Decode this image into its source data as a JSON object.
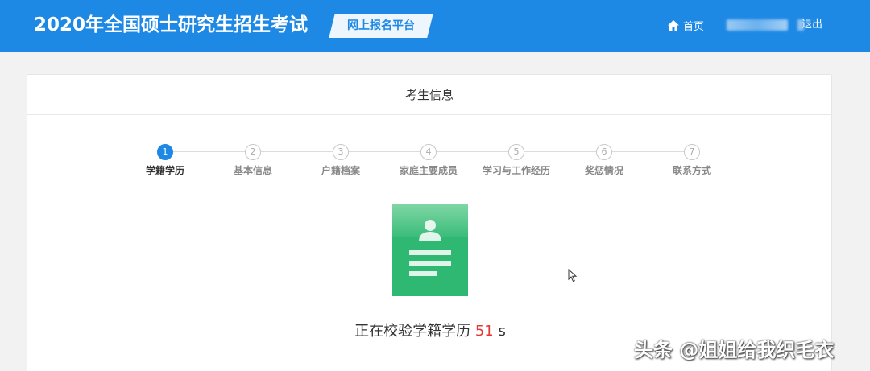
{
  "header": {
    "title": "2020年全国硕士研究生招生考试",
    "platform": "网上报名平台",
    "nav": {
      "home": "首页",
      "logout": "退出"
    }
  },
  "card": {
    "title": "考生信息",
    "steps": [
      {
        "num": "1",
        "label": "学籍学历",
        "active": true
      },
      {
        "num": "2",
        "label": "基本信息",
        "active": false
      },
      {
        "num": "3",
        "label": "户籍档案",
        "active": false
      },
      {
        "num": "4",
        "label": "家庭主要成员",
        "active": false
      },
      {
        "num": "5",
        "label": "学习与工作经历",
        "active": false
      },
      {
        "num": "6",
        "label": "奖惩情况",
        "active": false
      },
      {
        "num": "7",
        "label": "联系方式",
        "active": false
      }
    ],
    "verify": {
      "prefix": "正在校验学籍学历",
      "count": "51",
      "unit": "s"
    }
  },
  "watermark": "头条 @姐姐给我织毛衣",
  "colors": {
    "primary": "#1e88e5",
    "card_green": "#2fb872",
    "countdown": "#e53935"
  },
  "icons": {
    "home": "home-icon",
    "id_card": "id-card-icon",
    "cursor": "mouse-cursor-icon"
  }
}
